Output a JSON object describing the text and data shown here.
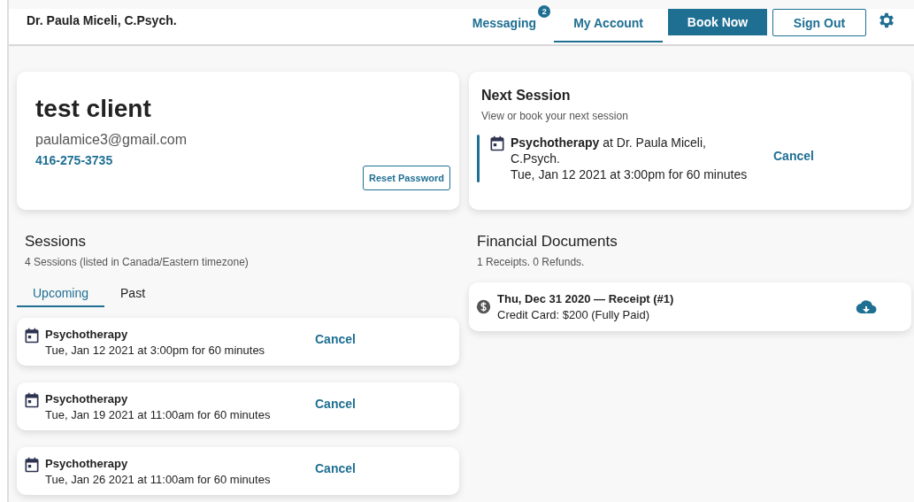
{
  "header": {
    "title": "Dr. Paula Miceli, C.Psych.",
    "nav": [
      {
        "label": "Messaging",
        "kind": "link",
        "badge": "2",
        "selected": false
      },
      {
        "label": "My Account",
        "kind": "link",
        "selected": true
      },
      {
        "label": "Book Now",
        "kind": "primary",
        "selected": false
      },
      {
        "label": "Sign Out",
        "kind": "outline",
        "selected": false
      }
    ]
  },
  "profile": {
    "name": "test client",
    "email": "paulamice3@gmail.com",
    "phone": "416-275-3735",
    "reset_button": "Reset Password"
  },
  "sessions": {
    "title": "Sessions",
    "subtitle": "4 Sessions (listed in Canada/Eastern timezone)",
    "tabs": [
      {
        "label": "Upcoming",
        "selected": true
      },
      {
        "label": "Past",
        "selected": false
      }
    ],
    "items": [
      {
        "service": "Psychotherapy",
        "when": "Tue, Jan 12 2021 at 3:00pm for 60 minutes",
        "action": "Cancel"
      },
      {
        "service": "Psychotherapy",
        "when": "Tue, Jan 19 2021 at 11:00am for 60 minutes",
        "action": "Cancel"
      },
      {
        "service": "Psychotherapy",
        "when": "Tue, Jan 26 2021 at 11:00am for 60 minutes",
        "action": "Cancel"
      }
    ]
  },
  "next_session": {
    "title": "Next Session",
    "subtitle": "View or book your next session",
    "service": "**Psychotherapy** at Dr. Paula Miceli, C.Psych.",
    "when": "Tue, Jan 12 2021 at 3:00pm for 60 minutes",
    "action": "Cancel"
  },
  "financial": {
    "title": "Financial Documents",
    "subtitle": "1 Receipts. 0 Refunds.",
    "items": [
      {
        "title": "Thu, Dec 31 2020 — Receipt (#1)",
        "detail": "Credit Card: $200 (Fully Paid)"
      }
    ]
  }
}
